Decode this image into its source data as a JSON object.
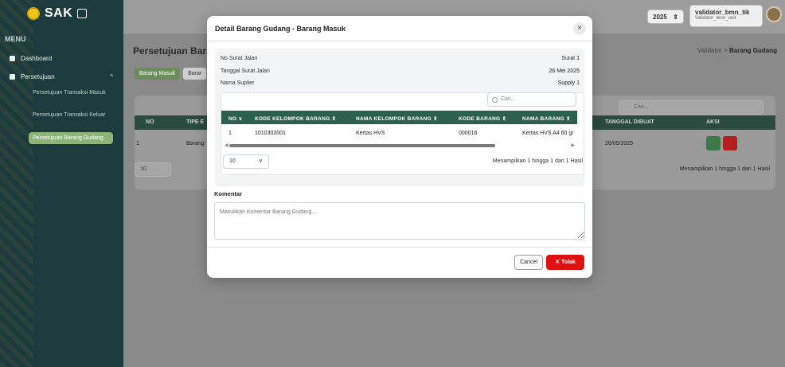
{
  "sidebar": {
    "brand": "SAK",
    "menu_title": "MENU",
    "items": [
      {
        "label": "Dashboard"
      },
      {
        "label": "Persetujuan"
      }
    ],
    "sub_items": [
      {
        "label": "Persetujuan Transaksi Masuk"
      },
      {
        "label": "Persetujuan Transaksi Keluar"
      },
      {
        "label": "Persetujuan Barang Gudang"
      }
    ]
  },
  "topbar": {
    "year": "2025",
    "user_name": "validator_bmn_tik",
    "user_role": "Validator_bmn_unit"
  },
  "page": {
    "title": "Persetujuan Barar",
    "breadcrumb_parent": "Validator",
    "breadcrumb_current": "Barang Gudang",
    "tabs": [
      "Barang Masuk",
      "Barar"
    ],
    "search_placeholder": "Cari...",
    "columns": [
      "NO",
      "TIPE E",
      "TANGGAL DIBUAT",
      "AKSI"
    ],
    "row": {
      "no": "1",
      "tipe": "Barang",
      "tanggal": "26/05/2025"
    },
    "page_size": "10",
    "info": "Menampilkan 1 hingga 1 dari 1 Hasil"
  },
  "modal": {
    "title": "Detail Barang Gudang - Barang Masuk",
    "close_icon": "×",
    "fields": [
      {
        "label": "No Surat Jalan",
        "value": "Surat 1"
      },
      {
        "label": "Tanggal Surat Jalan",
        "value": "26 Mei 2025"
      },
      {
        "label": "Nama Suplier",
        "value": "Supply 1"
      }
    ],
    "search_placeholder": "Cari...",
    "table": {
      "columns": [
        "NO",
        "KODE KELOMPOK BARANG",
        "NAMA KELOMPOK BARANG",
        "KODE BARANG",
        "NAMA BARANG"
      ],
      "rows": [
        [
          "1",
          "1010302001",
          "Kertas HVS",
          "000016",
          "Kertas HVS A4 60 gr"
        ]
      ]
    },
    "page_size": "10",
    "info": "Menampilkan 1 hingga 1 dari 1 Hasil",
    "comment_label": "Komentar",
    "comment_placeholder": "Masukkan Komentar Barang Gudang...",
    "cancel_label": "Cancel",
    "reject_label": "Tolak",
    "accent_color": "#2d5f4f",
    "reject_color": "#e01010"
  }
}
